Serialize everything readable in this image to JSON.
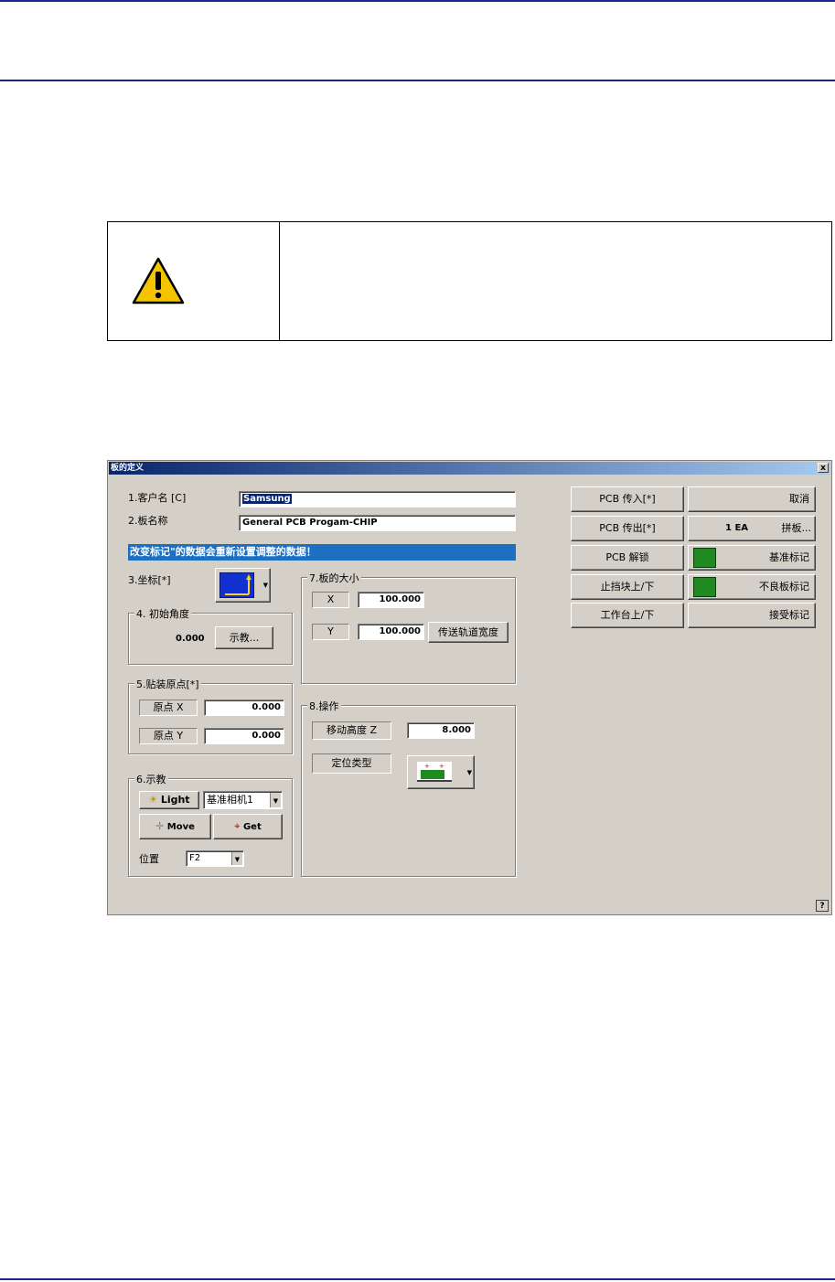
{
  "dialog": {
    "title": "板的定义",
    "close_glyph": "x",
    "customer_label": "1.客户名 [C]",
    "customer_value": "Samsung",
    "board_name_label": "2.板名称",
    "board_name_value": "General PCB Progam-CHIP",
    "notice": "改变标记\"的数据会重新设置调整的数据！",
    "coord_label": "3.坐标[*]",
    "angle_group": "4. 初始角度",
    "angle_value": "0.000",
    "teach_button": "示教...",
    "origin_group": "5.贴装原点[*]",
    "origin_x_label": "原点 X",
    "origin_x_value": "0.000",
    "origin_y_label": "原点 Y",
    "origin_y_value": "0.000",
    "teach_group": "6.示教",
    "light_button": "Light",
    "camera_select": "基准相机1",
    "move_button": "Move",
    "get_button": "Get",
    "position_label": "位置",
    "position_select": "F2",
    "size_group": "7.板的大小",
    "size_x_label": "X",
    "size_x_value": "100.000",
    "size_y_label": "Y",
    "size_y_value": "100.000",
    "conveyor_width_button": "传送轨道宽度",
    "op_group": "8.操作",
    "move_height_label": "移动高度 Z",
    "move_height_value": "8.000",
    "locate_type_label": "定位类型",
    "pcb_in_button": "PCB 传入[*]",
    "pcb_out_button": "PCB 传出[*]",
    "pcb_unlock_button": "PCB 解锁",
    "stopper_button": "止挡块上/下",
    "table_button": "工作台上/下",
    "cancel_button": "取消",
    "array_count": "1 EA",
    "array_button": "拼板...",
    "fiducial_button": "基准标记",
    "bad_mark_button": "不良板标记",
    "accept_mark_button": "接受标记",
    "help_glyph": "?"
  },
  "colors": {
    "rule": "#1a2a8a",
    "dialog_bg": "#d4d0c8",
    "notice_bg": "#1c6fc1",
    "mark_green": "#1f8a1f",
    "warning_yellow": "#f5c400"
  }
}
